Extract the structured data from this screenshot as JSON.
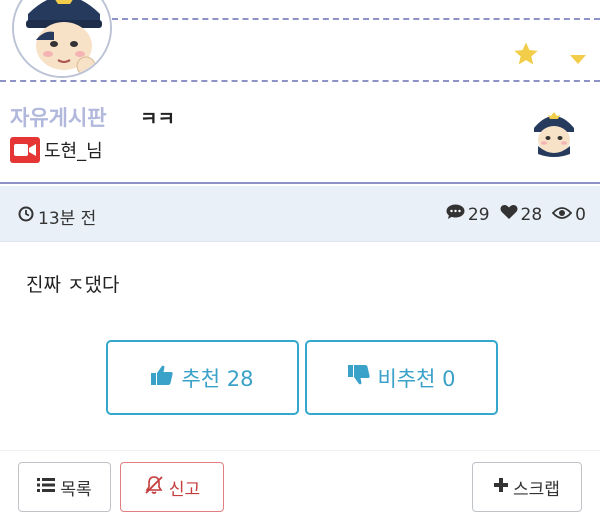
{
  "header": {
    "faded_nav": [
      "",
      "",
      "",
      ""
    ],
    "favorite_icon": "star-icon",
    "menu_icon": "caret-down-icon",
    "accent_color": "#8e92c6",
    "star_color": "#f2cd4a"
  },
  "post": {
    "board_name": "자유게시판",
    "title": "ㅋㅋ",
    "author": "도현_님",
    "author_badge_icon": "video-camera-icon",
    "time": "13분 전",
    "comments": "29",
    "likes": "28",
    "views": "0",
    "content": "진짜 ㅈ댔다"
  },
  "votes": {
    "up_label": "추천 28",
    "down_label": "비추천 0",
    "color": "#3aa1c8"
  },
  "toolbar": {
    "list_label": "목록",
    "report_label": "신고",
    "scrap_label": "스크랩"
  }
}
